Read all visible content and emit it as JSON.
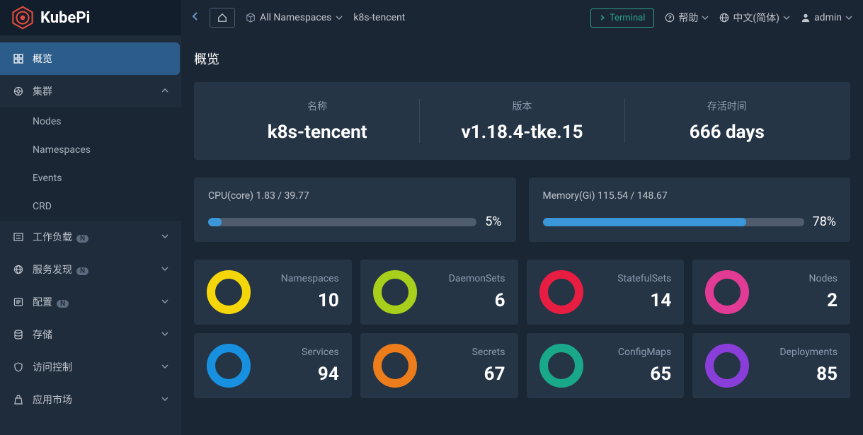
{
  "app": {
    "name": "KubePi"
  },
  "header": {
    "namespace_selector": "All Namespaces",
    "current_cluster": "k8s-tencent",
    "terminal_label": "Terminal",
    "help_label": "帮助",
    "language_label": "中文(简体)",
    "user_label": "admin"
  },
  "sidebar": {
    "overview": "概览",
    "cluster": "集群",
    "cluster_children": {
      "nodes": "Nodes",
      "namespaces": "Namespaces",
      "events": "Events",
      "crd": "CRD"
    },
    "workloads": "工作负载",
    "service_discovery": "服务发现",
    "config": "配置",
    "storage": "存储",
    "access_control": "访问控制",
    "marketplace": "应用市场",
    "badge_n": "N"
  },
  "page": {
    "title": "概览",
    "info": {
      "name_label": "名称",
      "name_value": "k8s-tencent",
      "version_label": "版本",
      "version_value": "v1.18.4-tke.15",
      "uptime_label": "存活时间",
      "uptime_value": "666 days"
    },
    "cpu": {
      "label": "CPU(core) 1.83 / 39.77",
      "pct": "5%",
      "fill": "5%"
    },
    "memory": {
      "label": "Memory(Gi) 115.54 / 148.67",
      "pct": "78%",
      "fill": "78%"
    },
    "resources": [
      {
        "name": "Namespaces",
        "count": "10",
        "color": "#f5d60a"
      },
      {
        "name": "DaemonSets",
        "count": "6",
        "color": "#a7cf1b"
      },
      {
        "name": "StatefulSets",
        "count": "14",
        "color": "#e71e42"
      },
      {
        "name": "Nodes",
        "count": "2",
        "color": "#e13b95"
      },
      {
        "name": "Services",
        "count": "94",
        "color": "#1890e0"
      },
      {
        "name": "Secrets",
        "count": "67",
        "color": "#ed7c1a"
      },
      {
        "name": "ConfigMaps",
        "count": "65",
        "color": "#1aa88a"
      },
      {
        "name": "Deployments",
        "count": "85",
        "color": "#8a3ed9"
      }
    ]
  }
}
